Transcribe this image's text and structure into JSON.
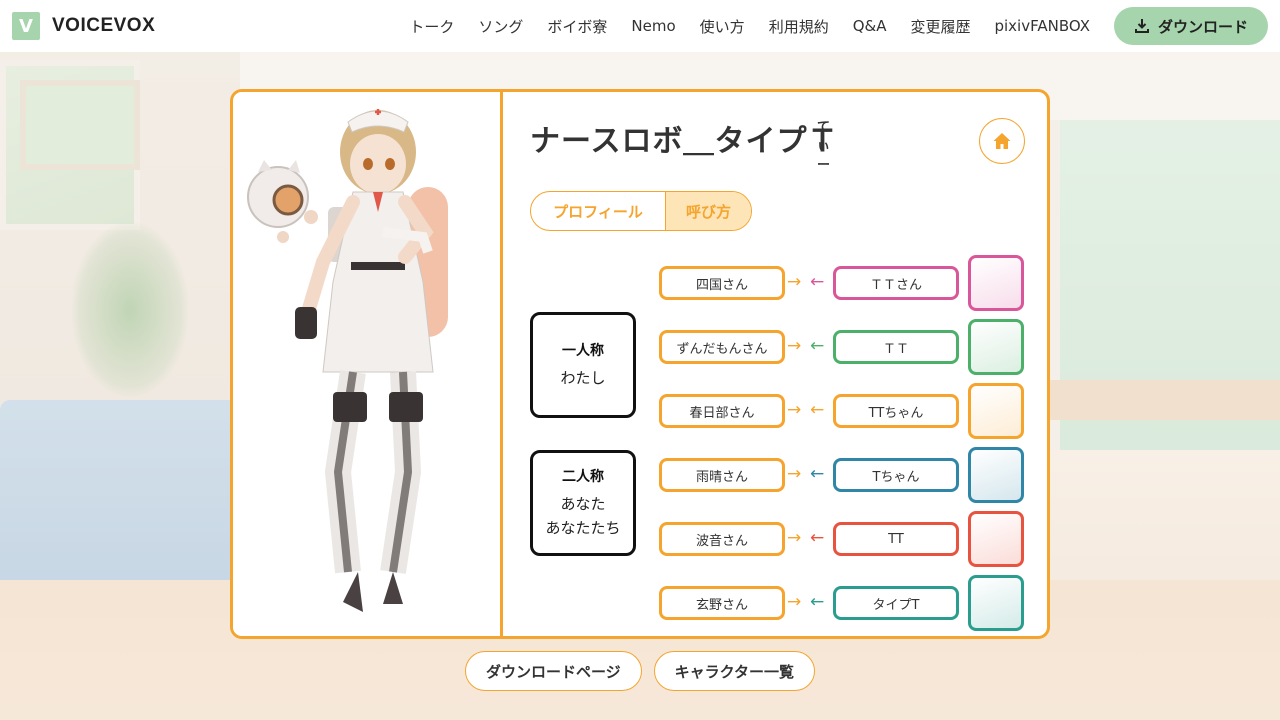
{
  "header": {
    "logo_letter": "V",
    "logo_text": "VOICEVOX",
    "nav": [
      "トーク",
      "ソング",
      "ボイボ寮",
      "Nemo",
      "使い方",
      "利用規約",
      "Q&A",
      "変更履歴",
      "pixivFANBOX"
    ],
    "download_label": "ダウンロード"
  },
  "character": {
    "name": "ナースロボ＿タイプＴ",
    "ruby": "てぃー"
  },
  "tabs": {
    "profile": "プロフィール",
    "calls": "呼び方"
  },
  "first_person": {
    "heading": "一人称",
    "values": [
      "わたし"
    ]
  },
  "second_person": {
    "heading": "二人称",
    "values": [
      "あなた",
      "あなたたち"
    ]
  },
  "calls": [
    {
      "mine": "四国さん",
      "theirs": "ＴＴさん",
      "color": "#d9569a",
      "arrow_color": "#d9569a",
      "icon": "metan-icon"
    },
    {
      "mine": "ずんだもんさん",
      "theirs": "ＴＴ",
      "color": "#4caf6a",
      "arrow_color": "#4caf6a",
      "icon": "zundamon-icon"
    },
    {
      "mine": "春日部さん",
      "theirs": "TTちゃん",
      "color": "#f5a42e",
      "arrow_color": "#f5a42e",
      "icon": "tsumugi-icon"
    },
    {
      "mine": "雨晴さん",
      "theirs": "Tちゃん",
      "color": "#2f86a6",
      "arrow_color": "#2f86a6",
      "icon": "hau-icon"
    },
    {
      "mine": "波音さん",
      "theirs": "TT",
      "color": "#e8533f",
      "arrow_color": "#e8533f",
      "icon": "ritsu-icon"
    },
    {
      "mine": "玄野さん",
      "theirs": "タイプT",
      "color": "#2a9d8f",
      "arrow_color": "#2a9d8f",
      "icon": "takehiro-icon"
    }
  ],
  "bottom": {
    "download_page": "ダウンロードページ",
    "character_list": "キャラクター一覧"
  },
  "colors": {
    "accent": "#f5a42e",
    "brand_green": "#a5d4ad"
  }
}
